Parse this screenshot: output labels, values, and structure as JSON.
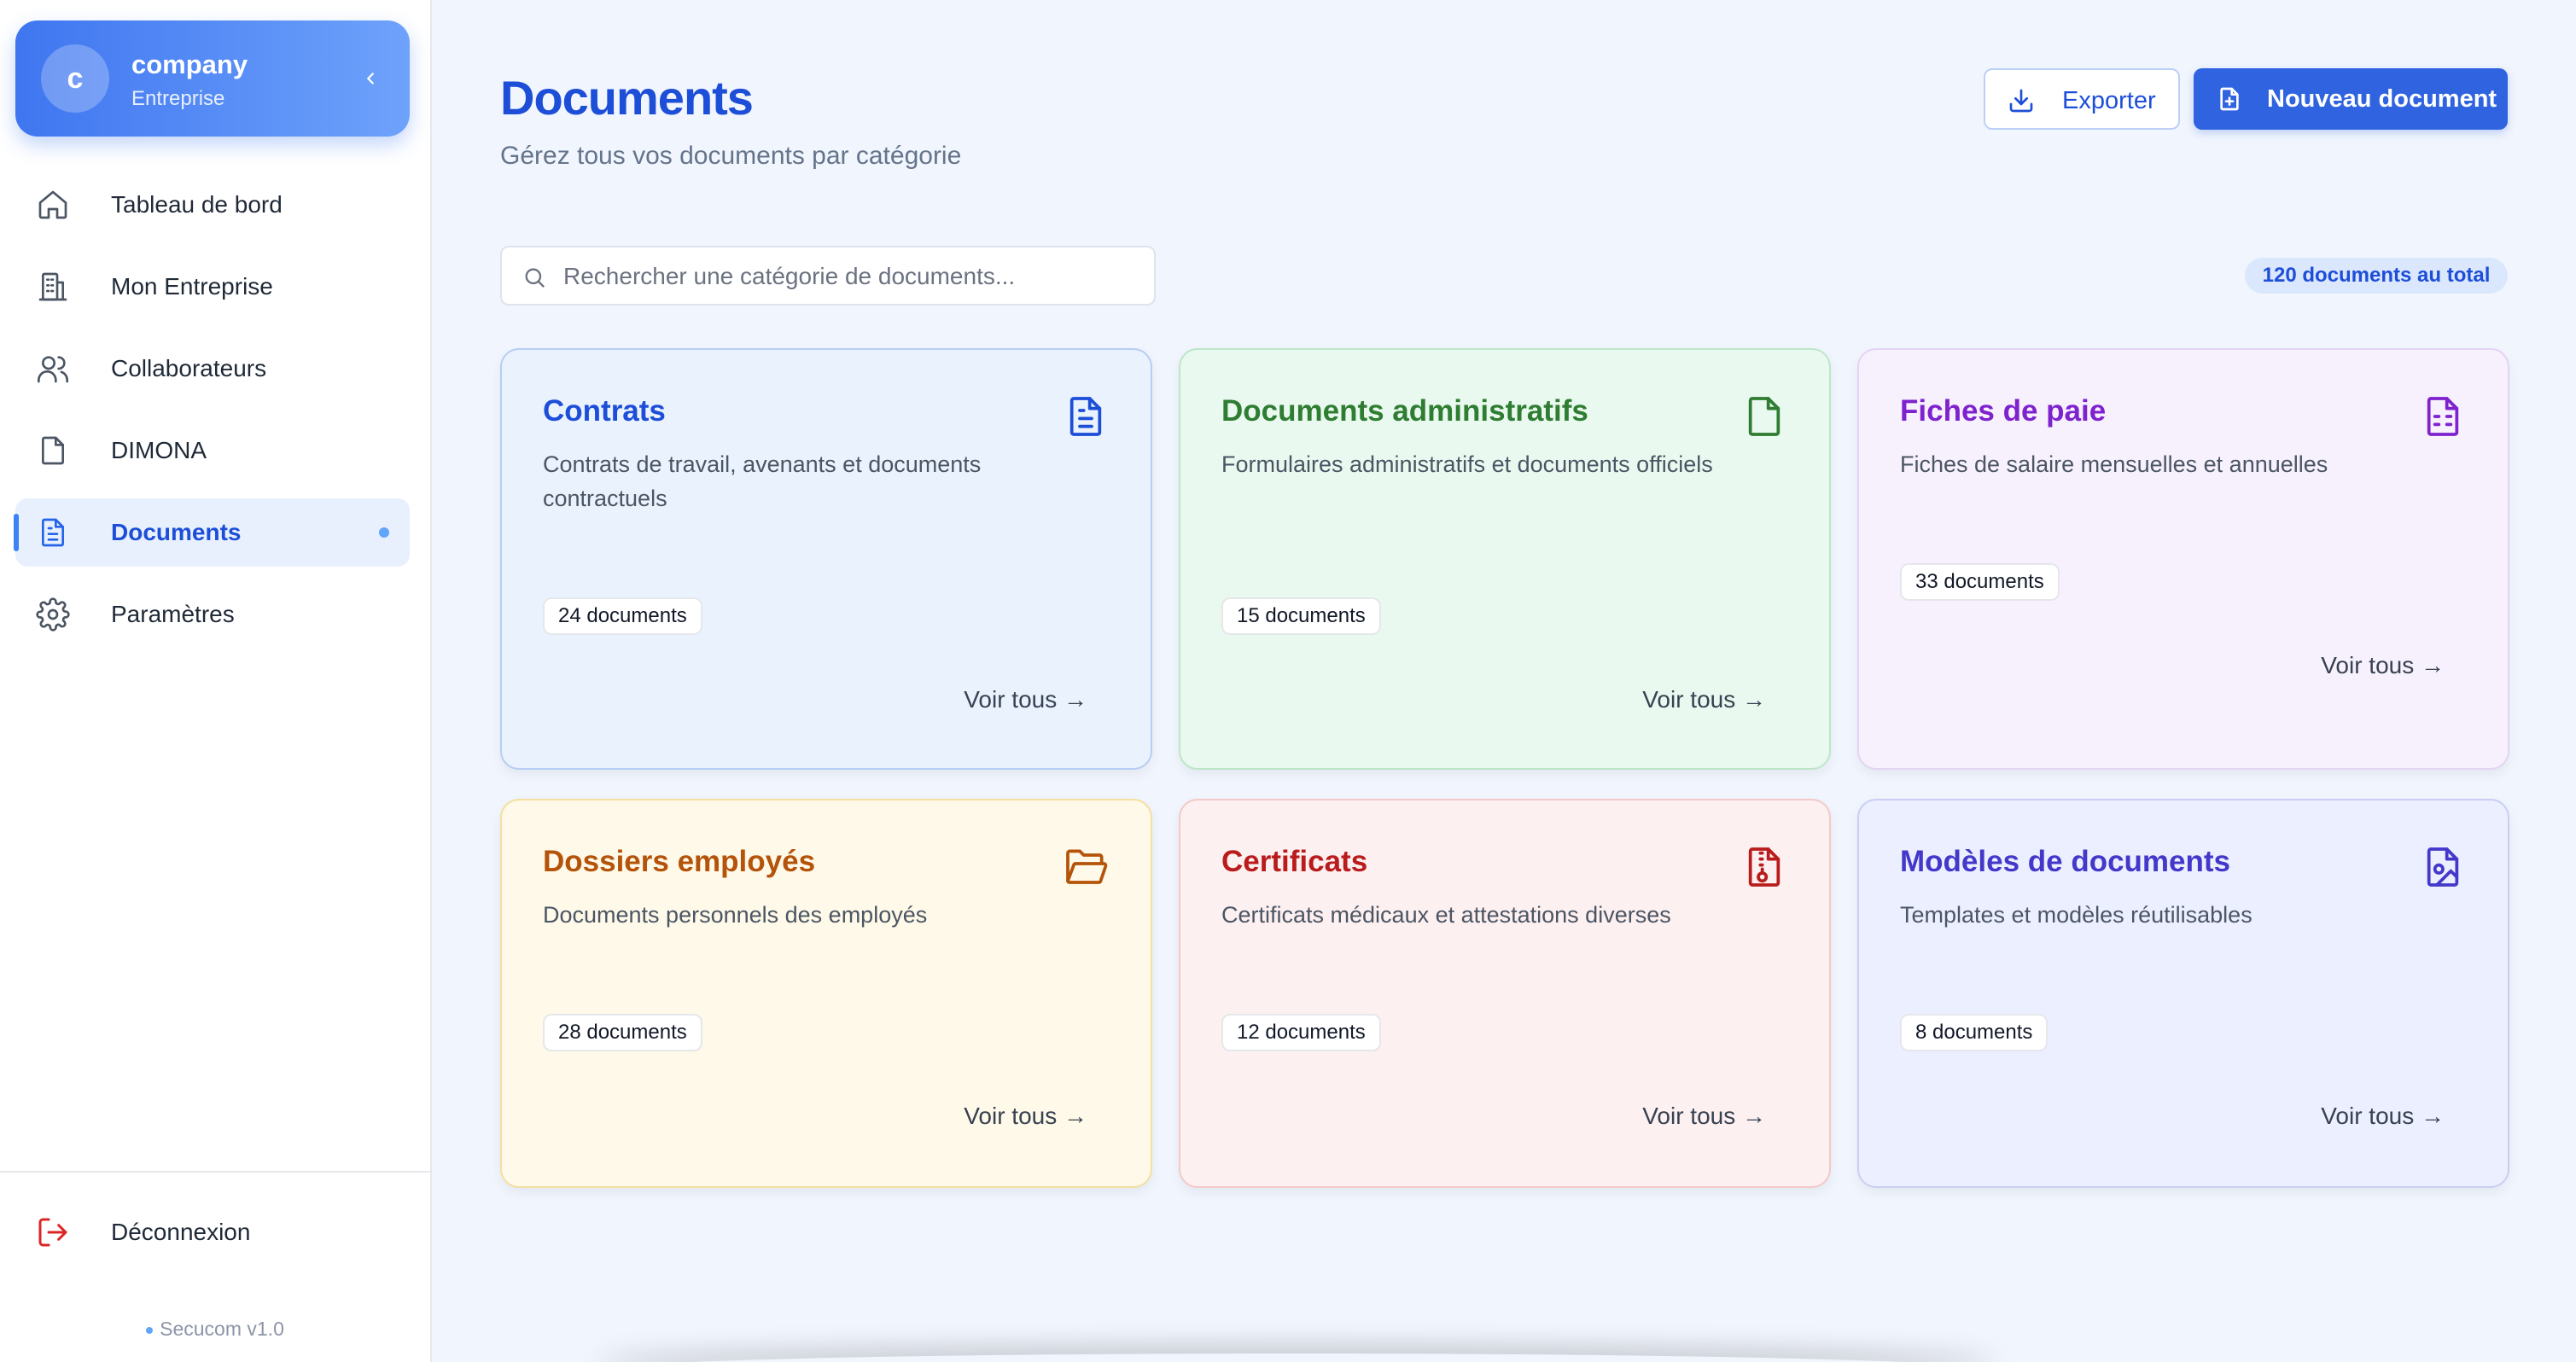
{
  "sidebar": {
    "company": {
      "initial": "c",
      "name": "company",
      "type": "Entreprise"
    },
    "items": [
      {
        "label": "Tableau de bord",
        "icon": "home-icon"
      },
      {
        "label": "Mon Entreprise",
        "icon": "building-icon"
      },
      {
        "label": "Collaborateurs",
        "icon": "users-icon"
      },
      {
        "label": "DIMONA",
        "icon": "file-icon"
      },
      {
        "label": "Documents",
        "icon": "file-text-icon",
        "active": true
      },
      {
        "label": "Paramètres",
        "icon": "gear-icon"
      }
    ],
    "logout_label": "Déconnexion",
    "version": "Secucom v1.0"
  },
  "header": {
    "title": "Documents",
    "subtitle": "Gérez tous vos documents par catégorie",
    "export_label": "Exporter",
    "new_label": "Nouveau document"
  },
  "search": {
    "placeholder": "Rechercher une catégorie de documents..."
  },
  "total_badge": "120 documents au total",
  "categories": [
    {
      "title": "Contrats",
      "description": "Contrats de travail, avenants et documents contractuels",
      "count": "24 documents",
      "link": "Voir tous →",
      "icon": "file-text-icon",
      "color": "#1d4ed8"
    },
    {
      "title": "Documents administratifs",
      "description": "Formulaires administratifs et documents officiels",
      "count": "15 documents",
      "link": "Voir tous →",
      "icon": "file-icon",
      "color": "#2e7d32"
    },
    {
      "title": "Fiches de paie",
      "description": "Fiches de salaire mensuelles et annuelles",
      "count": "33 documents",
      "link": "Voir tous →",
      "icon": "file-spreadsheet-icon",
      "color": "#7e22ce"
    },
    {
      "title": "Dossiers employés",
      "description": "Documents personnels des employés",
      "count": "28 documents",
      "link": "Voir tous →",
      "icon": "folder-open-icon",
      "color": "#b45309"
    },
    {
      "title": "Certificats",
      "description": "Certificats médicaux et attestations diverses",
      "count": "12 documents",
      "link": "Voir tous →",
      "icon": "file-archive-icon",
      "color": "#b91c1c"
    },
    {
      "title": "Modèles de documents",
      "description": "Templates et modèles réutilisables",
      "count": "8 documents",
      "link": "Voir tous →",
      "icon": "file-image-icon",
      "color": "#4338ca"
    }
  ],
  "colors": {
    "accent": "#2f63e0",
    "title": "#1d4ed8"
  }
}
